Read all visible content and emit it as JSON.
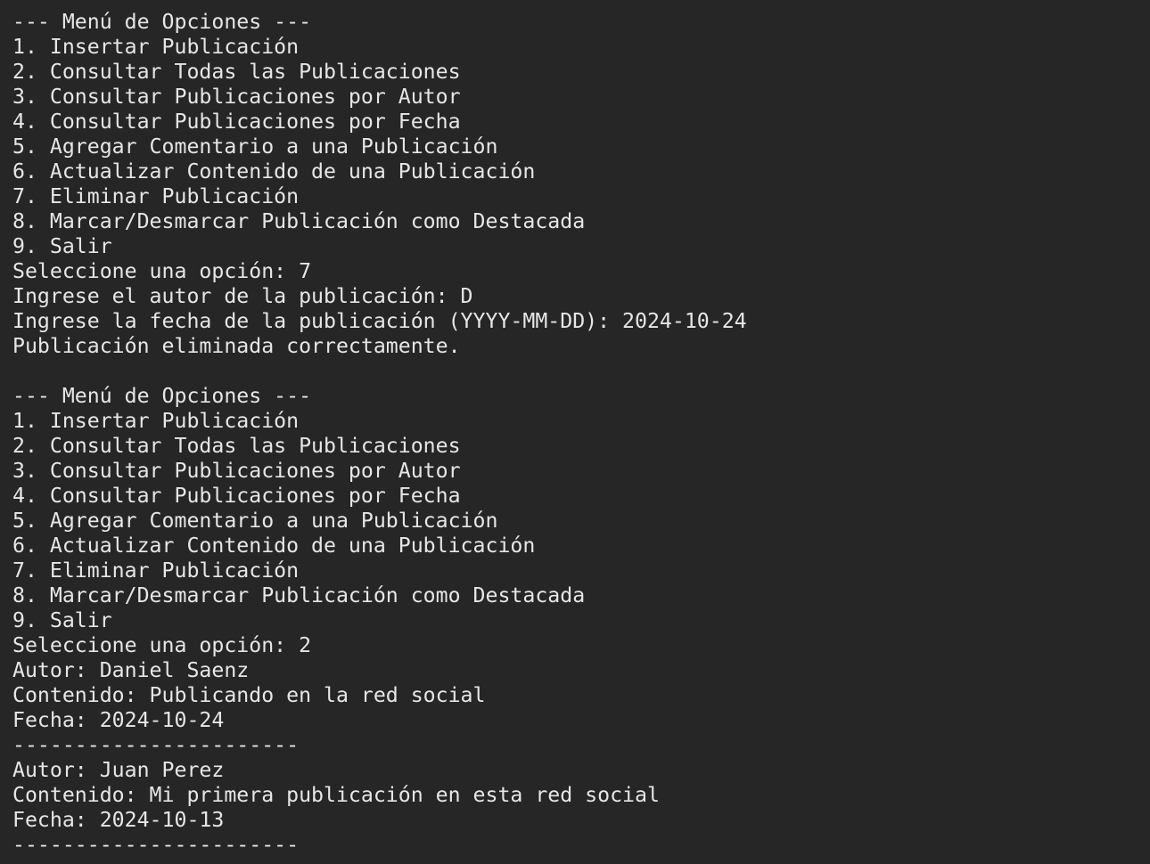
{
  "terminal": {
    "background": "#262626",
    "foreground": "#e6e6e6",
    "lines": [
      "--- Menú de Opciones ---",
      "1. Insertar Publicación",
      "2. Consultar Todas las Publicaciones",
      "3. Consultar Publicaciones por Autor",
      "4. Consultar Publicaciones por Fecha",
      "5. Agregar Comentario a una Publicación",
      "6. Actualizar Contenido de una Publicación",
      "7. Eliminar Publicación",
      "8. Marcar/Desmarcar Publicación como Destacada",
      "9. Salir",
      "Seleccione una opción: 7",
      "Ingrese el autor de la publicación: D",
      "Ingrese la fecha de la publicación (YYYY-MM-DD): 2024-10-24",
      "Publicación eliminada correctamente.",
      "",
      "--- Menú de Opciones ---",
      "1. Insertar Publicación",
      "2. Consultar Todas las Publicaciones",
      "3. Consultar Publicaciones por Autor",
      "4. Consultar Publicaciones por Fecha",
      "5. Agregar Comentario a una Publicación",
      "6. Actualizar Contenido de una Publicación",
      "7. Eliminar Publicación",
      "8. Marcar/Desmarcar Publicación como Destacada",
      "9. Salir",
      "Seleccione una opción: 2",
      "Autor: Daniel Saenz",
      "Contenido: Publicando en la red social",
      "Fecha: 2024-10-24",
      "-----------------------",
      "Autor: Juan Perez",
      "Contenido: Mi primera publicación en esta red social",
      "Fecha: 2024-10-13",
      "-----------------------"
    ]
  }
}
